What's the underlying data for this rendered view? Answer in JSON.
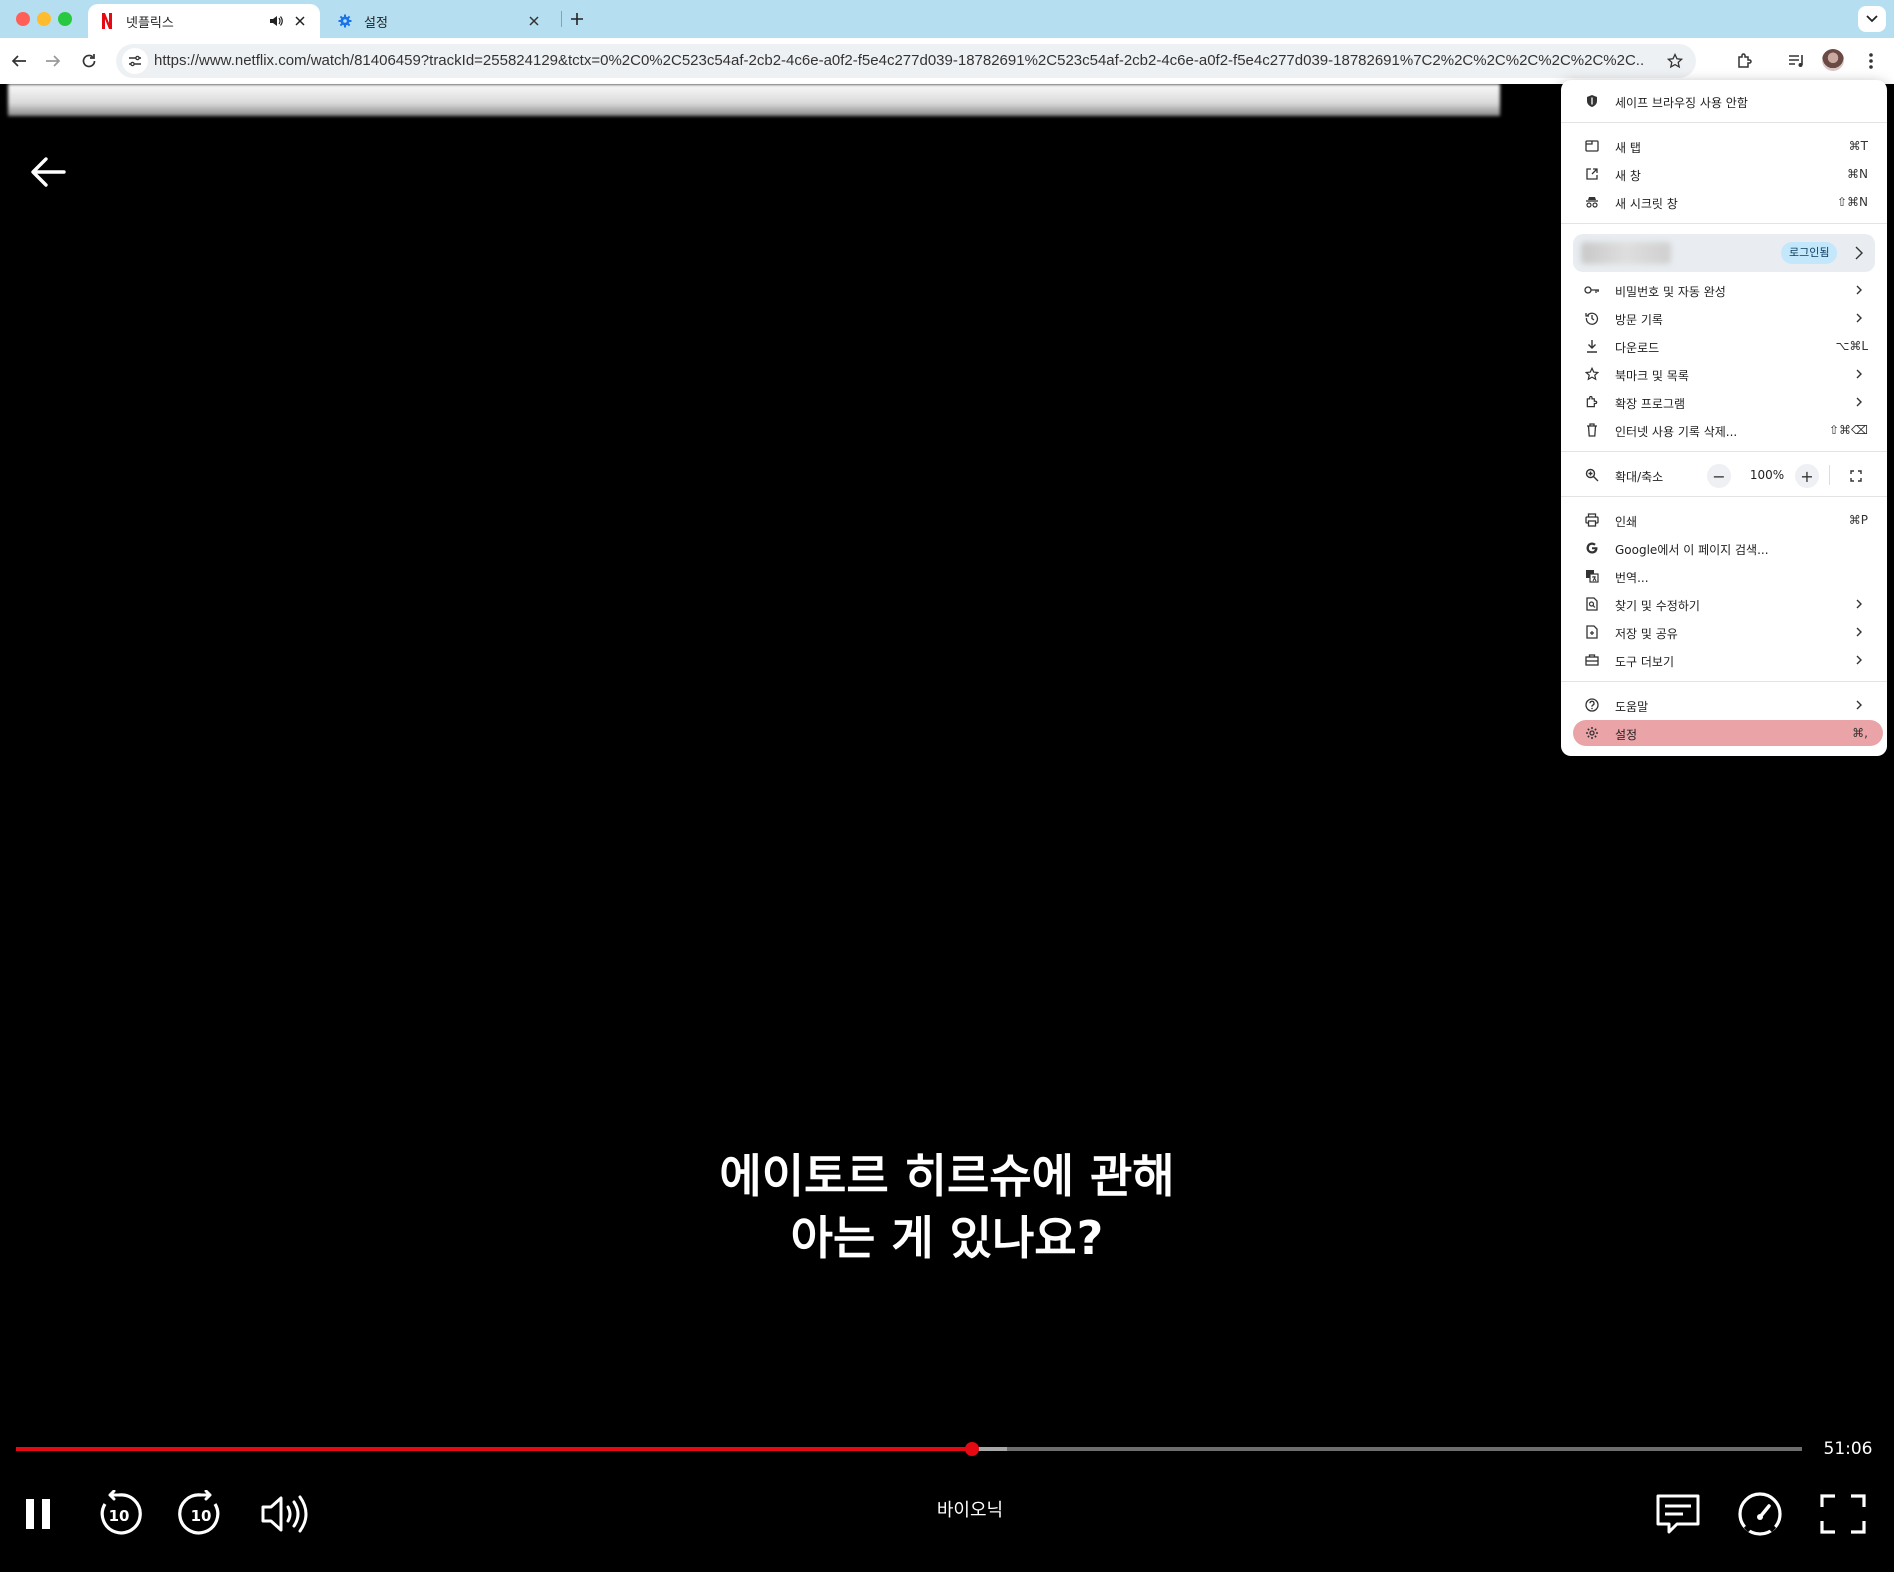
{
  "browser": {
    "tabs": [
      {
        "title": "넷플릭스",
        "favicon": "netflix-icon",
        "active": true
      },
      {
        "title": "설정",
        "favicon": "gear-icon",
        "active": false
      }
    ],
    "url": "https://www.netflix.com/watch/81406459?trackId=255824129&tctx=0%2C0%2C523c54af-2cb2-4c6e-a0f2-f5e4c277d039-18782691%2C523c54af-2cb2-4c6e-a0f2-f5e4c277d039-18782691%7C2%2C%2C%2C%2C%2C%2C..."
  },
  "player": {
    "subtitle_lines": [
      "에이토르 히르슈에 관해",
      "아는 게 있나요?"
    ],
    "episode_title": "바이오닉",
    "time_remaining": "51:06",
    "progress": 0.535,
    "buffered": 0.555,
    "skip_back_label": "10",
    "skip_forward_label": "10"
  },
  "menu": {
    "safe_browsing": "세이프 브라우징 사용 안함",
    "new_tab": {
      "label": "새 탭",
      "shortcut": "⌘T"
    },
    "new_window": {
      "label": "새 창",
      "shortcut": "⌘N"
    },
    "new_incognito": {
      "label": "새 시크릿 창",
      "shortcut": "⇧⌘N"
    },
    "profile_badge": "로그인됨",
    "passwords": "비밀번호 및 자동 완성",
    "history": "방문 기록",
    "downloads": {
      "label": "다운로드",
      "shortcut": "⌥⌘L"
    },
    "bookmarks": "북마크 및 목록",
    "extensions": "확장 프로그램",
    "clear_data": {
      "label": "인터넷 사용 기록 삭제...",
      "shortcut": "⇧⌘⌫"
    },
    "zoom": {
      "label": "확대/축소",
      "minus": "−",
      "value": "100%",
      "plus": "+"
    },
    "print": {
      "label": "인쇄",
      "shortcut": "⌘P"
    },
    "google_search": "Google에서 이 페이지 검색...",
    "translate": "번역...",
    "find_edit": "찾기 및 수정하기",
    "save_share": "저장 및 공유",
    "more_tools": "도구 더보기",
    "help": "도움말",
    "settings": {
      "label": "설정",
      "shortcut": "⌘,"
    }
  },
  "colors": {
    "netflix_red": "#e50914",
    "tabstrip": "#b5dff0",
    "highlight": "#eaa3a6"
  }
}
